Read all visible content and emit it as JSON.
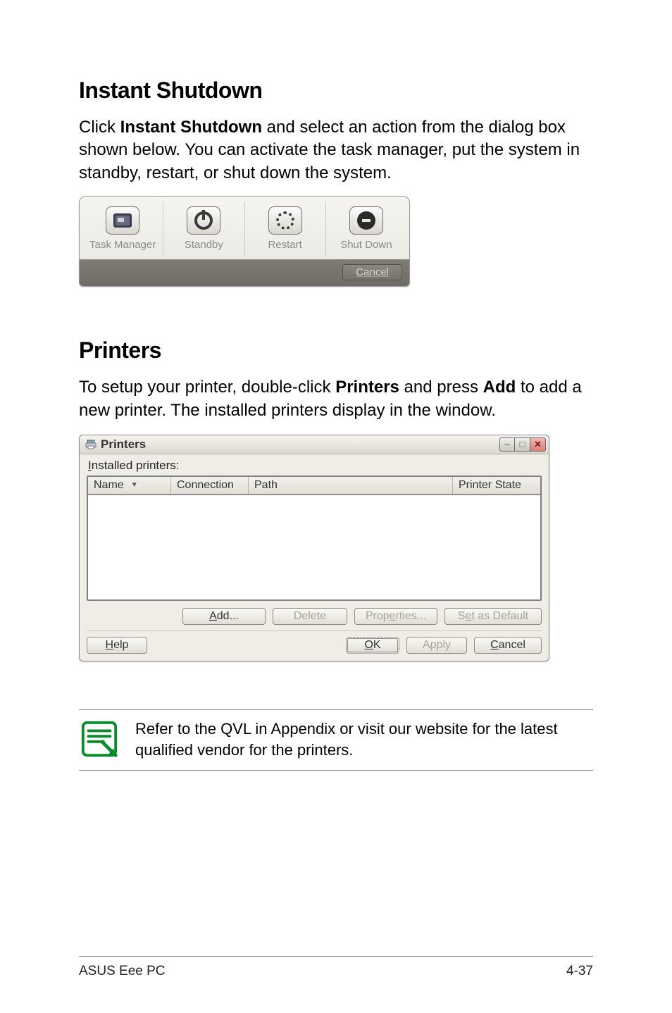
{
  "section1": {
    "heading": "Instant Shutdown",
    "para_pre": "Click ",
    "para_bold": "Instant Shutdown",
    "para_post": " and select an action from the dialog box shown below. You can activate the task manager, put the system in standby, restart, or shut down the system."
  },
  "shutdown_dialog": {
    "items": [
      {
        "label": "Task Manager"
      },
      {
        "label": "Standby"
      },
      {
        "label": "Restart"
      },
      {
        "label": "Shut Down"
      }
    ],
    "cancel": "Cancel"
  },
  "section2": {
    "heading": "Printers",
    "para_pre": "To setup your printer, double-click ",
    "para_bold1": "Printers",
    "para_mid": " and press ",
    "para_bold2": "Add",
    "para_post": " to add a new printer. The installed printers display in the window."
  },
  "printers_window": {
    "title": "Printers",
    "installed_prefix": "I",
    "installed_rest": "nstalled printers:",
    "columns": {
      "name": "Name",
      "connection": "Connection",
      "path": "Path",
      "state": "Printer State"
    },
    "buttons": {
      "add_u": "A",
      "add_rest": "dd...",
      "delete": "Delete",
      "prop_pre": "Prop",
      "prop_u": "e",
      "prop_post": "rties...",
      "def_pre": "S",
      "def_u": "e",
      "def_post": "t as Default",
      "help_u": "H",
      "help_rest": "elp",
      "ok_u": "O",
      "ok_rest": "K",
      "apply": "Apply",
      "cancel_u": "C",
      "cancel_rest": "ancel"
    }
  },
  "note": {
    "text": "Refer to the QVL in Appendix or visit our website for the latest qualified vendor for the printers."
  },
  "footer": {
    "left": "ASUS Eee PC",
    "right": "4-37"
  }
}
